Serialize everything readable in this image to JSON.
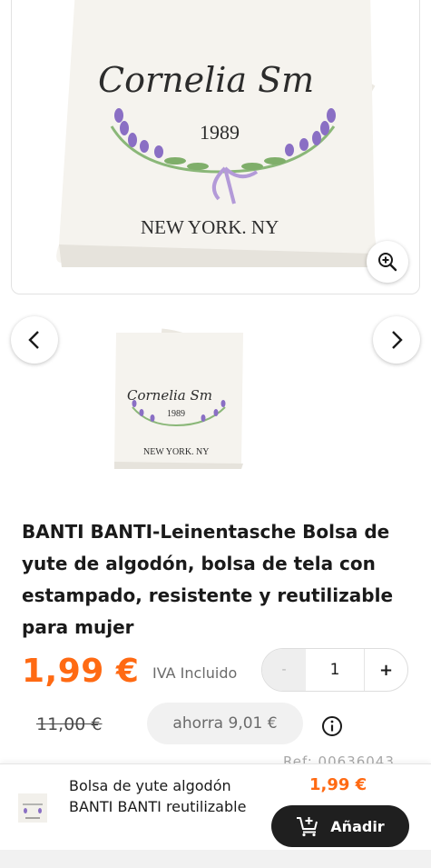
{
  "product_image": {
    "print_name": "Cornelia Sm",
    "print_year": "1989",
    "print_city": "NEW YORK. NY"
  },
  "icons": {
    "zoom": "zoom-in-icon",
    "prev": "chevron-left-icon",
    "next": "chevron-right-icon",
    "info": "info-icon",
    "cart": "cart-add-icon"
  },
  "product": {
    "title": "BANTI BANTI-Leinentasche Bolsa de yute de algodón, bolsa de tela con estampado, resistente y reutilizable para mujer",
    "price": "1,99 €",
    "tax_note": "IVA Incluido",
    "old_price": "11,00 €",
    "savings": "ahorra 9,01 €",
    "ref": "Ref: 00636043"
  },
  "quantity": {
    "minus_label": "-",
    "value": "1",
    "plus_label": "+"
  },
  "bottom_bar": {
    "name": "Bolsa de yute algodón BANTI BANTI reutilizable",
    "price": "1,99 €",
    "add_label": "Añadir"
  },
  "colors": {
    "accent": "#ff6a13",
    "button_dark": "#1f1f1f",
    "lavender": "#8a6fc4",
    "leaf": "#7fae6a"
  }
}
